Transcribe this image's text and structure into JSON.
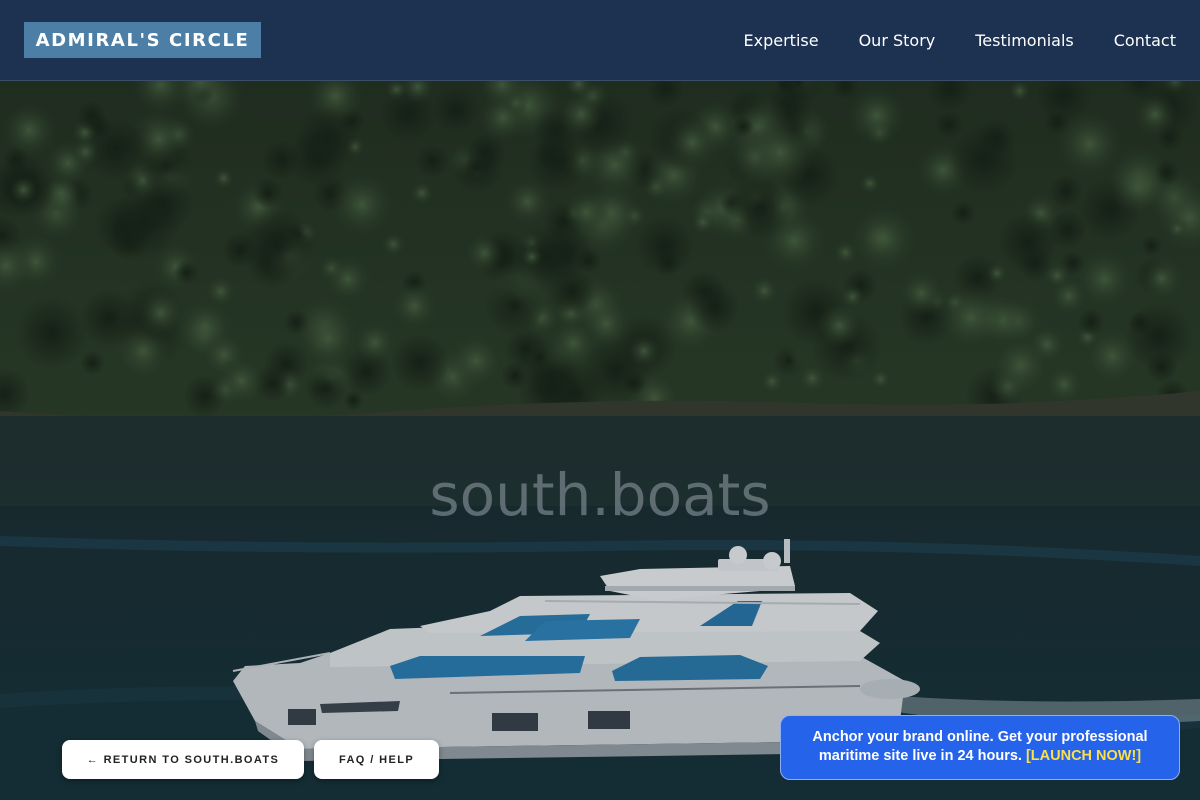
{
  "header": {
    "brand": "ADMIRAL'S CIRCLE",
    "nav": [
      "Expertise",
      "Our Story",
      "Testimonials",
      "Contact"
    ]
  },
  "hero": {
    "watermark": "south.boats",
    "scene": "forested hillside above calm water with a white motor yacht"
  },
  "buttons": {
    "return_label": "← RETURN TO SOUTH.BOATS",
    "faq_label": "FAQ / HELP"
  },
  "promo": {
    "text": "Anchor your brand online. Get your professional maritime site live in 24 hours.",
    "cta": "[LAUNCH NOW!]"
  },
  "colors": {
    "header_bg": "#1d3150",
    "brand_bg": "#4d7fa6",
    "promo_bg": "#2563eb",
    "promo_cta": "#fde047"
  }
}
